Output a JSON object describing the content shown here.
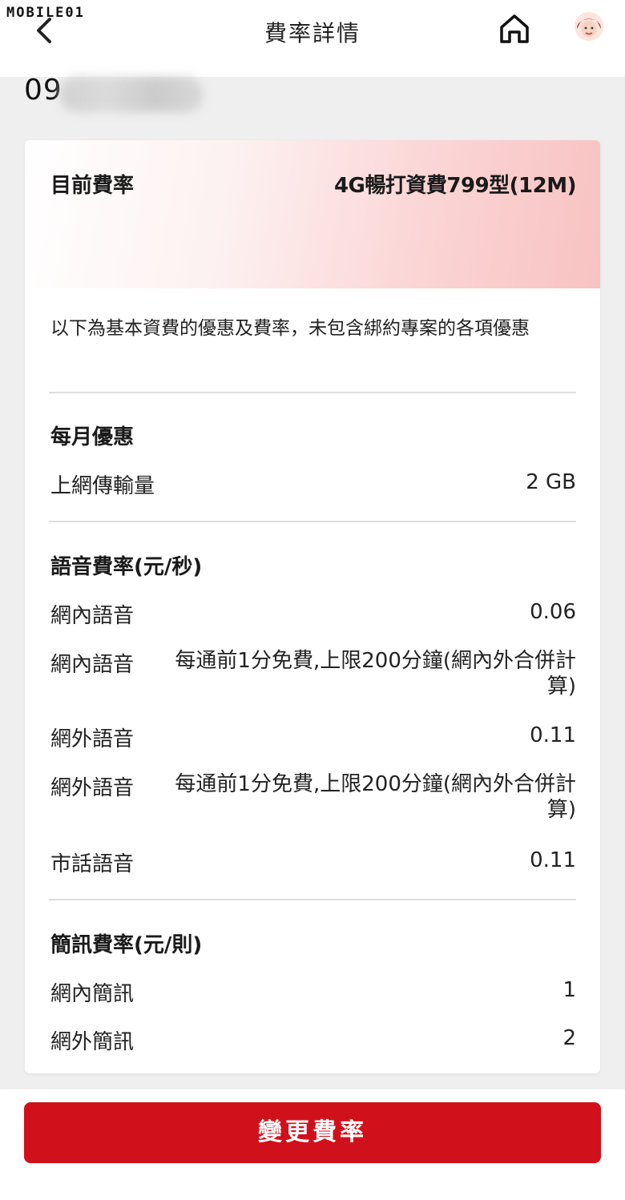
{
  "watermark": "MOBILE01",
  "header": {
    "title": "費率詳情"
  },
  "account": {
    "phone_prefix": "09"
  },
  "plan": {
    "label": "目前費率",
    "value": "4G暢打資費799型(12M)"
  },
  "note": "以下為基本資費的優惠及費率，未包含綁約專案的各項優惠",
  "monthly": {
    "title": "每月優惠",
    "rows": [
      {
        "label": "上網傳輸量",
        "value": "2 GB"
      }
    ]
  },
  "voice": {
    "title": "語音費率(元/秒)",
    "rows": [
      {
        "label": "網內語音",
        "value": "0.06"
      },
      {
        "label": "網內語音",
        "value": "每通前1分免費,上限200分鐘(網內外合併計算)"
      },
      {
        "label": "網外語音",
        "value": "0.11"
      },
      {
        "label": "網外語音",
        "value": "每通前1分免費,上限200分鐘(網內外合併計算)"
      },
      {
        "label": "市話語音",
        "value": "0.11"
      }
    ]
  },
  "sms": {
    "title": "簡訊費率(元/則)",
    "rows": [
      {
        "label": "網內簡訊",
        "value": "1"
      },
      {
        "label": "網外簡訊",
        "value": "2"
      }
    ]
  },
  "footer": {
    "button_label": "變更費率"
  },
  "colors": {
    "accent": "#d0111b",
    "card_gradient": "#f8c2c2"
  }
}
